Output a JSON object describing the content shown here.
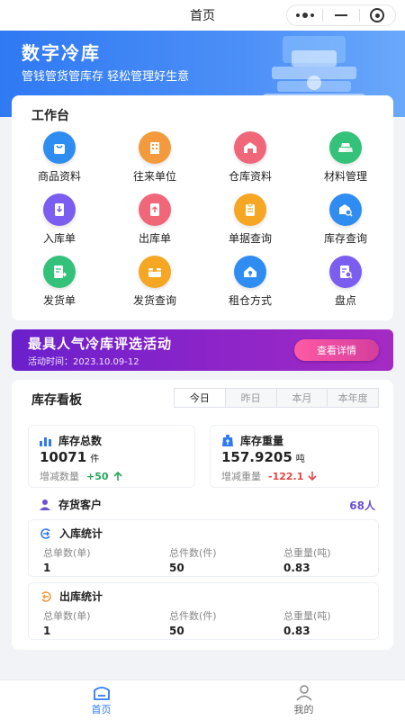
{
  "topbar": {
    "title": "首页",
    "menu_icon": "more-dots-icon",
    "minimize_icon": "minimize-icon",
    "close_icon": "target-close-icon"
  },
  "banner": {
    "title": "数字冷库",
    "subtitle": "管钱管货管库存  轻松管理好生意",
    "bg_color": "#2f79f2"
  },
  "workbench": {
    "title": "工作台",
    "items": [
      {
        "label": "商品资料",
        "icon": "shopping-bag-icon",
        "color": "#2f8cf0"
      },
      {
        "label": "往来单位",
        "icon": "building-icon",
        "color": "#f39a3c"
      },
      {
        "label": "仓库资料",
        "icon": "warehouse-icon",
        "color": "#f0677a"
      },
      {
        "label": "材料管理",
        "icon": "gold-bars-icon",
        "color": "#34c27a"
      },
      {
        "label": "入库单",
        "icon": "inbound-doc-icon",
        "color": "#7b5df0"
      },
      {
        "label": "出库单",
        "icon": "outbound-doc-icon",
        "color": "#f0677a"
      },
      {
        "label": "单据查询",
        "icon": "clipboard-icon",
        "color": "#f5a623"
      },
      {
        "label": "库存查询",
        "icon": "inventory-search-icon",
        "color": "#2f8cf0"
      },
      {
        "label": "发货单",
        "icon": "shipping-doc-icon",
        "color": "#34c27a"
      },
      {
        "label": "发货查询",
        "icon": "box-icon",
        "color": "#f5a623"
      },
      {
        "label": "租仓方式",
        "icon": "house-key-icon",
        "color": "#2f8cf0"
      },
      {
        "label": "盘点",
        "icon": "stocktake-icon",
        "color": "#7b5df0"
      }
    ]
  },
  "promo": {
    "title": "最具人气冷库评选活动",
    "time": "活动时间：2023.10.09-12",
    "button": "查看详情"
  },
  "board": {
    "title": "库存看板",
    "tabs": [
      "今日",
      "昨日",
      "本月",
      "本年度"
    ],
    "active_tab": "今日",
    "total_count": {
      "label": "库存总数",
      "value": "10071",
      "unit": "件",
      "change_label": "增减数量",
      "change": "+50",
      "trend": "up"
    },
    "total_weight": {
      "label": "库存重量",
      "value": "157.9205",
      "unit": "吨",
      "change_label": "增减重量",
      "change": "-122.1",
      "trend": "down"
    },
    "clients": {
      "label": "存货客户",
      "value": "68人"
    },
    "inbound": {
      "title": "入库统计",
      "headers": [
        "总单数(单)",
        "总件数(件)",
        "总重量(吨)"
      ],
      "values": [
        "1",
        "50",
        "0.83"
      ]
    },
    "outbound": {
      "title": "出库统计",
      "headers": [
        "总单数(单)",
        "总件数(件)",
        "总重量(吨)"
      ],
      "values": [
        "1",
        "50",
        "0.83"
      ]
    }
  },
  "tabbar": {
    "items": [
      {
        "label": "首页",
        "icon": "home-icon",
        "active": true
      },
      {
        "label": "我的",
        "icon": "user-icon",
        "active": false
      }
    ],
    "accent": "#2f79f2"
  }
}
